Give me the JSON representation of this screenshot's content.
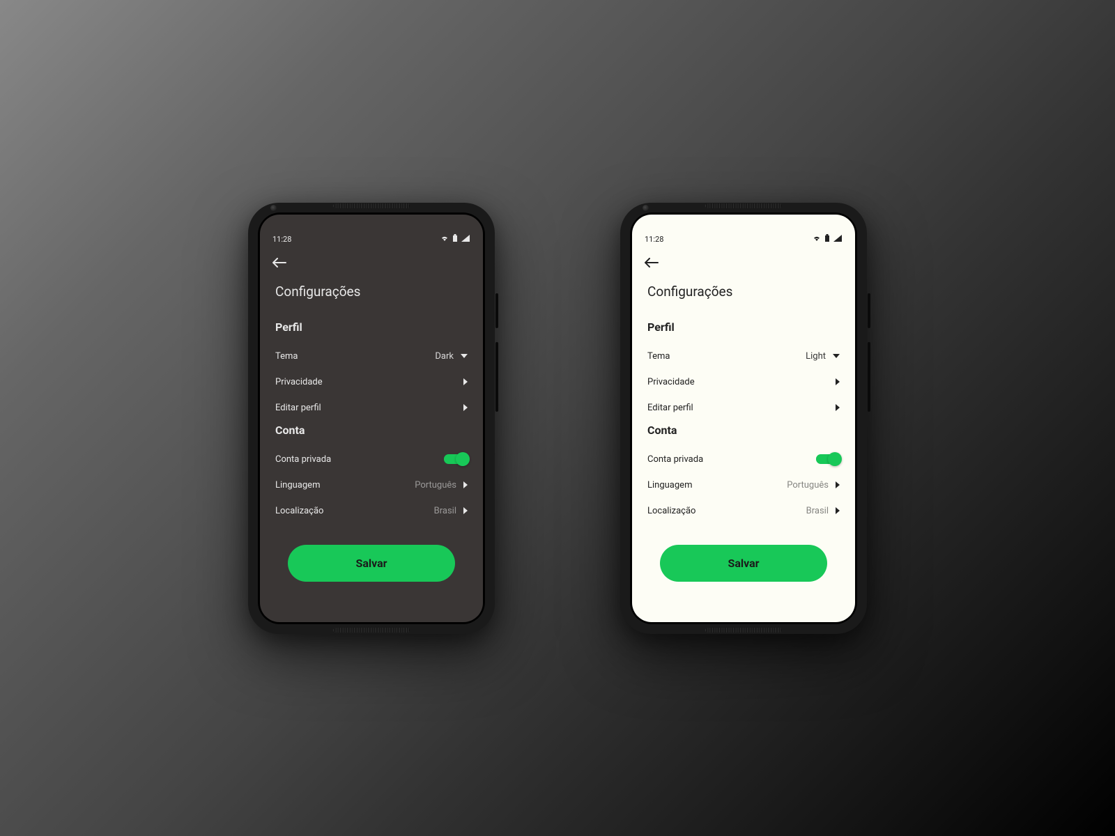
{
  "colors": {
    "accent": "#18c858"
  },
  "statusBar": {
    "time": "11:28"
  },
  "page": {
    "title": "Configurações"
  },
  "sections": {
    "profile": {
      "title": "Perfil",
      "theme": {
        "label": "Tema",
        "valueDark": "Dark",
        "valueLight": "Light"
      },
      "privacy": {
        "label": "Privacidade"
      },
      "editProfile": {
        "label": "Editar perfil"
      }
    },
    "account": {
      "title": "Conta",
      "privateAccount": {
        "label": "Conta privada",
        "enabled": true
      },
      "language": {
        "label": "Linguagem",
        "value": "Português"
      },
      "location": {
        "label": "Localização",
        "value": "Brasil"
      }
    }
  },
  "saveButton": {
    "label": "Salvar"
  }
}
